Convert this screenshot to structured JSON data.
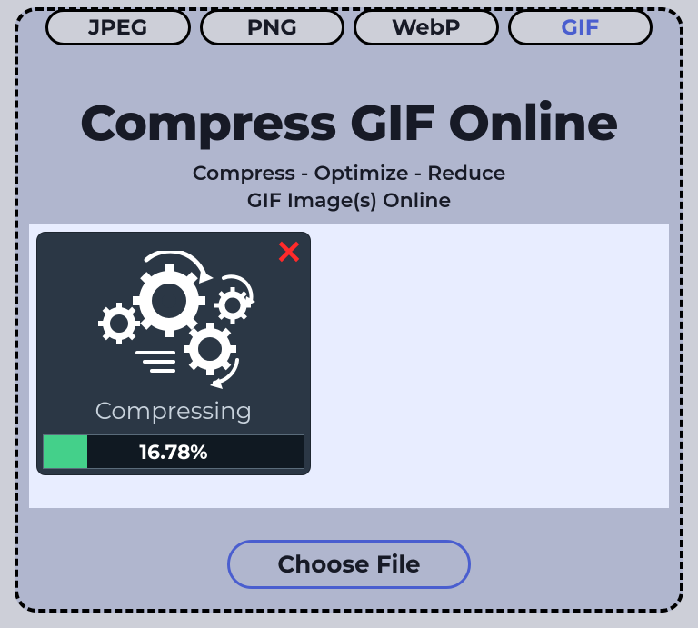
{
  "tabs": {
    "jpeg": "JPEG",
    "png": "PNG",
    "webp": "WebP",
    "gif": "GIF",
    "active": "gif"
  },
  "title": "Compress GIF Online",
  "subtitle_line1": "Compress - Optimize - Reduce",
  "subtitle_line2": "GIF Image(s) Online",
  "card": {
    "close": "✕",
    "status": "Compressing",
    "progress_percent": 16.78,
    "progress_label": "16.78%"
  },
  "choose_label": "Choose File"
}
